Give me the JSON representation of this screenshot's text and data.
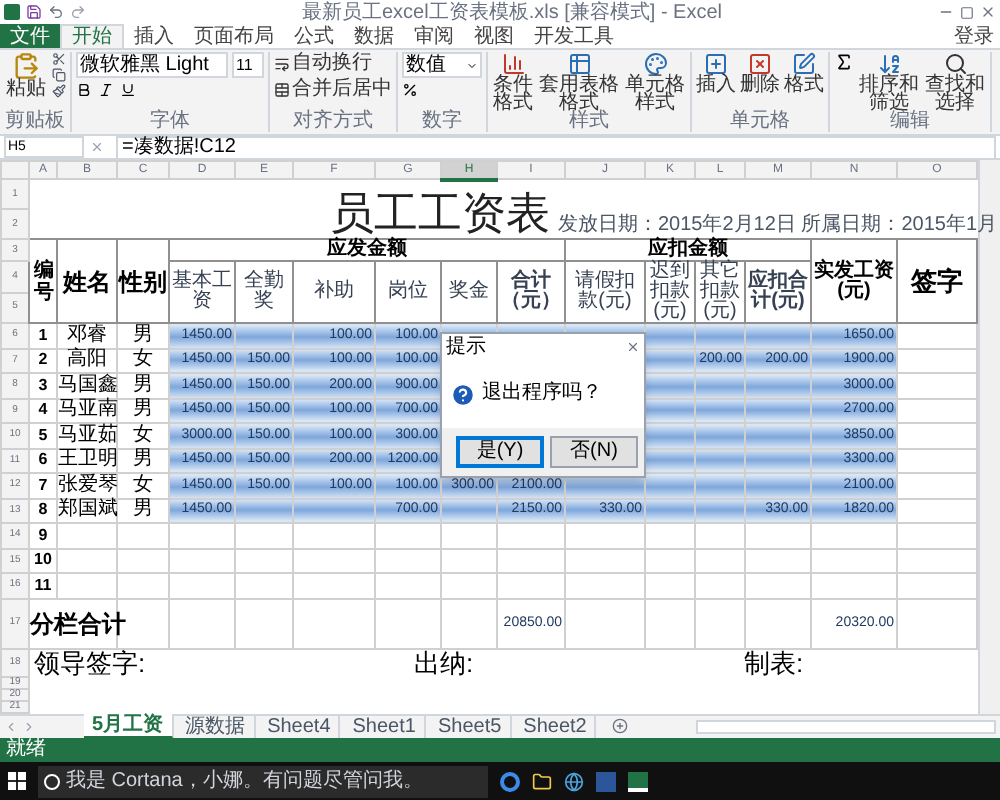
{
  "window": {
    "title": "最新员工excel工资表模板.xls [兼容模式] - Excel"
  },
  "ribbon": {
    "tabs": [
      {
        "label": "文件",
        "kind": "file",
        "selected": false
      },
      {
        "label": "开始",
        "kind": "tab",
        "selected": true
      },
      {
        "label": "插入",
        "kind": "tab",
        "selected": false
      },
      {
        "label": "页面布局",
        "kind": "tab",
        "selected": false
      },
      {
        "label": "公式",
        "kind": "tab",
        "selected": false
      },
      {
        "label": "数据",
        "kind": "tab",
        "selected": false
      },
      {
        "label": "审阅",
        "kind": "tab",
        "selected": false
      },
      {
        "label": "视图",
        "kind": "tab",
        "selected": false
      },
      {
        "label": "开发工具",
        "kind": "tab",
        "selected": false
      }
    ],
    "sign_in": "登录",
    "groups": [
      {
        "kind": "clipboard",
        "label": "剪贴板",
        "buttons": [
          "粘贴"
        ]
      },
      {
        "kind": "font",
        "label": "字体",
        "font_name": "微软雅黑 Light",
        "font_size": "11"
      },
      {
        "kind": "align",
        "label": "对齐方式",
        "buttons": [
          "自动换行",
          "合并后居中"
        ]
      },
      {
        "kind": "number",
        "label": "数字",
        "format": "数值"
      },
      {
        "kind": "styles",
        "label": "样式",
        "buttons": [
          "条件格式",
          "套用表格格式",
          "单元格样式"
        ]
      },
      {
        "kind": "cells",
        "label": "单元格",
        "buttons": [
          "插入",
          "删除",
          "格式"
        ]
      },
      {
        "kind": "editing",
        "label": "编辑",
        "buttons": [
          "排序和筛选",
          "查找和选择"
        ]
      }
    ]
  },
  "formula_bar": {
    "name_box": "H5",
    "formula": "=凑数据!C12"
  },
  "sheet": {
    "columns": [
      {
        "label": "A",
        "selected": false
      },
      {
        "label": "B",
        "selected": false
      },
      {
        "label": "C",
        "selected": false
      },
      {
        "label": "D",
        "selected": false
      },
      {
        "label": "E",
        "selected": false
      },
      {
        "label": "F",
        "selected": false
      },
      {
        "label": "G",
        "selected": false
      },
      {
        "label": "H",
        "selected": true
      },
      {
        "label": "I",
        "selected": false
      },
      {
        "label": "J",
        "selected": false
      },
      {
        "label": "K",
        "selected": false
      },
      {
        "label": "L",
        "selected": false
      },
      {
        "label": "M",
        "selected": false
      },
      {
        "label": "N",
        "selected": false
      },
      {
        "label": "O",
        "selected": false
      }
    ],
    "row_numbers": [
      "1",
      "2",
      "3",
      "4",
      "5",
      "6",
      "7",
      "8",
      "9",
      "10",
      "11",
      "12",
      "13",
      "14",
      "15",
      "16",
      "17",
      "18",
      "19",
      "20",
      "21"
    ],
    "title": "员工工资表",
    "date_text": "发放日期：2015年2月12日 所属日期：2015年1月",
    "group_headers": [
      "应发金额",
      "应扣金额"
    ],
    "headers": {
      "no": "编号",
      "name": "姓名",
      "gender": "性别",
      "columns": [
        "基本工资",
        "全勤奖",
        "补助",
        "岗位",
        "奖金",
        "合计（元）",
        "请假扣款(元)",
        "迟到扣款(元)",
        "其它扣款(元)",
        "应扣合计(元)"
      ],
      "net": "实发工资(元)",
      "signature": "签字"
    },
    "rows": [
      {
        "no": "1",
        "name": "邓睿",
        "gender": "男",
        "highlighted": true,
        "cells": [
          "1450.00",
          null,
          "100.00",
          "100.00",
          null,
          null,
          null,
          null,
          null,
          null,
          "1650.00"
        ]
      },
      {
        "no": "2",
        "name": "高阳",
        "gender": "女",
        "highlighted": true,
        "cells": [
          "1450.00",
          "150.00",
          "100.00",
          "100.00",
          null,
          null,
          null,
          null,
          "200.00",
          "200.00",
          "1900.00"
        ]
      },
      {
        "no": "3",
        "name": "马国鑫",
        "gender": "男",
        "highlighted": true,
        "cells": [
          "1450.00",
          "150.00",
          "200.00",
          "900.00",
          null,
          null,
          null,
          null,
          null,
          null,
          "3000.00"
        ]
      },
      {
        "no": "4",
        "name": "马亚南",
        "gender": "男",
        "highlighted": true,
        "cells": [
          "1450.00",
          "150.00",
          "100.00",
          "700.00",
          null,
          null,
          null,
          null,
          null,
          null,
          "2700.00"
        ]
      },
      {
        "no": "5",
        "name": "马亚茹",
        "gender": "女",
        "highlighted": true,
        "cells": [
          "3000.00",
          "150.00",
          "100.00",
          "300.00",
          null,
          null,
          null,
          null,
          null,
          null,
          "3850.00"
        ]
      },
      {
        "no": "6",
        "name": "王卫明",
        "gender": "男",
        "highlighted": true,
        "cells": [
          "1450.00",
          "150.00",
          "200.00",
          "1200.00",
          null,
          null,
          null,
          null,
          null,
          null,
          "3300.00"
        ]
      },
      {
        "no": "7",
        "name": "张爱琴",
        "gender": "女",
        "highlighted": true,
        "cells": [
          "1450.00",
          "150.00",
          "100.00",
          "100.00",
          "300.00",
          "2100.00",
          null,
          null,
          null,
          null,
          "2100.00"
        ]
      },
      {
        "no": "8",
        "name": "郑国斌",
        "gender": "男",
        "highlighted": true,
        "cells": [
          "1450.00",
          null,
          null,
          "700.00",
          null,
          "2150.00",
          "330.00",
          null,
          null,
          "330.00",
          "1820.00"
        ]
      },
      {
        "no": "9",
        "highlighted": false
      },
      {
        "no": "10",
        "highlighted": false
      },
      {
        "no": "11",
        "highlighted": false
      }
    ],
    "total": {
      "label": "分栏合计",
      "cells": [
        null,
        null,
        null,
        null,
        null,
        "20850.00",
        null,
        null,
        null,
        null,
        "20320.00"
      ]
    },
    "footer": [
      "领导签字:",
      "出纳:",
      "制表:"
    ]
  },
  "dialog": {
    "title": "提示",
    "message": "退出程序吗？",
    "buttons": [
      {
        "label": "是(Y)",
        "selected": true
      },
      {
        "label": "否(N)",
        "selected": false
      }
    ]
  },
  "sheet_tabs": [
    {
      "label": "5月工资",
      "selected": true
    },
    {
      "label": "源数据",
      "selected": false
    },
    {
      "label": "Sheet4",
      "selected": false
    },
    {
      "label": "Sheet1",
      "selected": false
    },
    {
      "label": "Sheet5",
      "selected": false
    },
    {
      "label": "Sheet2",
      "selected": false
    }
  ],
  "status_bar": {
    "text": "就绪"
  },
  "taskbar": {
    "search_placeholder": "我是 Cortana，小娜。有问题尽管问我。"
  }
}
